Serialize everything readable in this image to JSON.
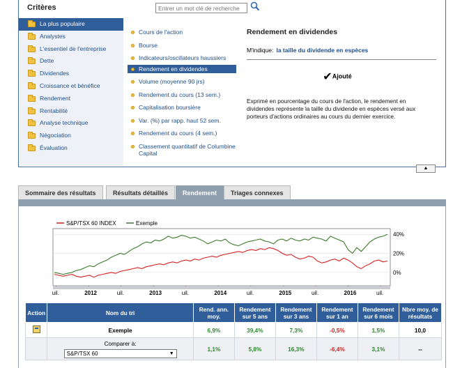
{
  "criteria": {
    "title": "Critères",
    "search_placeholder": "Entrer un mot clé de recherche",
    "categories": [
      {
        "label": "La plus populaire",
        "selected": true
      },
      {
        "label": "Analystes",
        "selected": false
      },
      {
        "label": "L'essentiel de l'entreprise",
        "selected": false
      },
      {
        "label": "Dette",
        "selected": false
      },
      {
        "label": "Dividendes",
        "selected": false
      },
      {
        "label": "Croissance et bénéfice",
        "selected": false
      },
      {
        "label": "Rendement",
        "selected": false
      },
      {
        "label": "Rentabilité",
        "selected": false
      },
      {
        "label": "Analyse technique",
        "selected": false
      },
      {
        "label": "Négociation",
        "selected": false
      },
      {
        "label": "Évaluation",
        "selected": false
      }
    ],
    "items": [
      {
        "label": "Cours de l'action",
        "selected": false
      },
      {
        "label": "Bourse",
        "selected": false
      },
      {
        "label": "Indicateurs/oscillateurs haussiers",
        "selected": false
      },
      {
        "label": "Rendement en dividendes",
        "selected": true
      },
      {
        "label": "Volume (moyenne 90 jrs)",
        "selected": false
      },
      {
        "label": "Rendement du cours (13 sem.)",
        "selected": false
      },
      {
        "label": "Capitalisation boursière",
        "selected": false
      },
      {
        "label": "Var. (%) par rapp. haut 52 sem.",
        "selected": false
      },
      {
        "label": "Rendement du cours (4 sem.)",
        "selected": false
      },
      {
        "label": "Classement quantitatif de Columbine Capital",
        "selected": false
      }
    ],
    "detail": {
      "title": "Rendement en dividendes",
      "indique_label": "M'indique:",
      "indique_link": "la taille du dividende en espèces",
      "added_label": "Ajouté",
      "description": "Exprimé en pourcentage du cours de l'action, le rendement en dividendes représente la taille du dividende en espèces versé aux porteurs d'actions ordinaires au cours du dernier exercice."
    },
    "collapse_glyph": "▲"
  },
  "tabs": [
    {
      "label": "Sommaire des résultats",
      "active": false
    },
    {
      "label": "Résultats détaillés",
      "active": false
    },
    {
      "label": "Rendement",
      "active": true
    },
    {
      "label": "Triages connexes",
      "active": false
    }
  ],
  "colors": {
    "accent": "#2f5e9a",
    "tab_active": "#8f9fae",
    "series_index": "#d42020",
    "series_example": "#3a7a2a",
    "positive": "#2a8a2a",
    "negative": "#d02020"
  },
  "chart_data": {
    "type": "line",
    "series": [
      {
        "name": "S&P/TSX 60 INDEX",
        "color": "#d42020",
        "values": [
          -2,
          -3,
          -4,
          -3,
          -2,
          -4,
          -5,
          -4,
          -3,
          -5,
          -3,
          -2,
          -1,
          0,
          -1,
          1,
          2,
          3,
          4,
          5,
          4,
          6,
          7,
          8,
          9,
          8,
          10,
          11,
          10,
          12,
          13,
          12,
          14,
          13,
          15,
          16,
          17,
          16,
          18,
          19,
          20,
          21,
          22,
          21,
          23,
          24,
          23,
          25,
          24,
          26,
          25,
          23,
          20,
          18,
          19,
          16,
          14,
          15,
          17,
          16,
          12,
          10,
          11,
          13,
          14,
          12,
          15,
          13,
          10,
          6,
          4,
          7,
          9,
          12,
          13,
          11,
          12
        ]
      },
      {
        "name": "Exemple",
        "color": "#3a7a2a",
        "values": [
          0,
          -1,
          -2,
          -1,
          0,
          2,
          3,
          5,
          7,
          6,
          9,
          11,
          13,
          16,
          18,
          20,
          19,
          22,
          25,
          27,
          30,
          32,
          31,
          34,
          33,
          35,
          38,
          36,
          37,
          39,
          38,
          36,
          37,
          35,
          33,
          30,
          32,
          34,
          33,
          35,
          31,
          29,
          28,
          30,
          32,
          33,
          34,
          35,
          33,
          32,
          30,
          34,
          35,
          33,
          36,
          34,
          33,
          35,
          34,
          37,
          36,
          35,
          33,
          38,
          36,
          34,
          32,
          24,
          20,
          26,
          22,
          27,
          32,
          35,
          37,
          38,
          40
        ]
      }
    ],
    "x_tick_labels": [
      "uil.",
      "2012",
      "uil.",
      "2013",
      "uil.",
      "2014",
      "uil.",
      "2015",
      "uil.",
      "2016",
      "uil."
    ],
    "y_tick_labels": [
      "40%",
      "20%",
      "0%"
    ],
    "ylim": [
      -14,
      46
    ],
    "legend_position": "top-left"
  },
  "table": {
    "headers": [
      "Action",
      "Nom du tri",
      "Rend. ann. moy.",
      "Rendement sur 5 ans",
      "Rendement sur 3 ans",
      "Rendement sur 1 an",
      "Rendement sur 6 mois",
      "Nbre moy. de résultats"
    ],
    "row_example": {
      "name": "Exemple",
      "values": [
        "6,9%",
        "39,4%",
        "7,3%",
        "-0,5%",
        "1,5%",
        "10,0"
      ]
    },
    "row_compare": {
      "label": "Comparer à:",
      "select_value": "S&P/TSX 60",
      "values": [
        "1,1%",
        "5,8%",
        "16,3%",
        "-6,4%",
        "3,1%",
        "--"
      ]
    }
  }
}
